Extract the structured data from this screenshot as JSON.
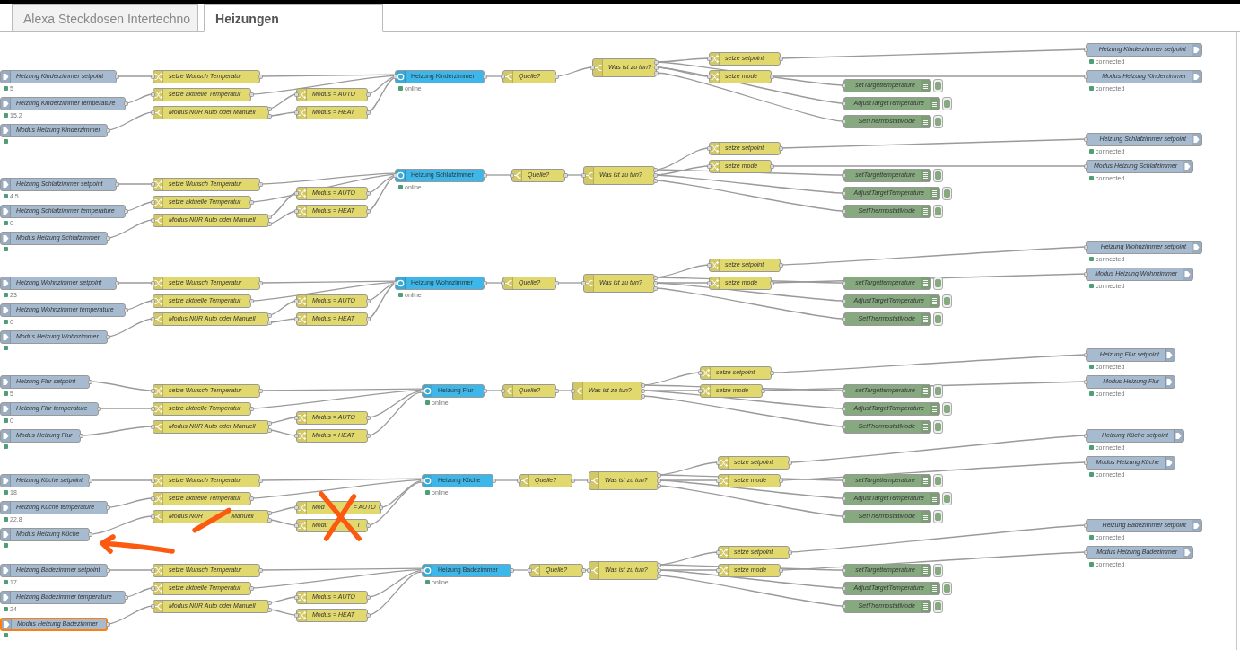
{
  "tabs": [
    {
      "label": "Alexa Steckdosen Intertechno",
      "selected": false
    },
    {
      "label": "Heizungen",
      "selected": true
    }
  ],
  "flow": [
    {
      "nodes": [
        {
          "kind": "input",
          "label": "Heizung Kinderzimmer setpoint",
          "selected": false,
          "status_dot": true,
          "status": "5"
        },
        {
          "kind": "input",
          "label": "Heizung Kinderzimmer temperature",
          "selected": false,
          "status_dot": true,
          "status": "15.2"
        },
        {
          "kind": "input",
          "label": "Modus Heizung Kinderzimmer",
          "selected": false,
          "status_dot": true
        },
        {
          "kind": "change",
          "label": "setze Wunsch Temperatur",
          "selected": false
        },
        {
          "kind": "change",
          "label": "setze aktuelle Temperatur",
          "selected": false
        },
        {
          "kind": "switch",
          "label": "Modus NUR Auto oder Manuell",
          "selected": false
        },
        {
          "kind": "change",
          "label": "Modus = AUTO",
          "selected": false
        },
        {
          "kind": "change",
          "label": "Modus = HEAT",
          "selected": false
        },
        {
          "kind": "device",
          "label": "Heizung Kinderzimmer",
          "selected": false,
          "status_dot": true,
          "status": "online"
        },
        {
          "kind": "switch",
          "label": "Quelle?",
          "selected": false
        },
        {
          "kind": "switch",
          "label": "Was ist zu tun?",
          "selected": false
        },
        {
          "kind": "change",
          "label": "setze setpoint",
          "selected": false
        },
        {
          "kind": "change",
          "label": "setze mode",
          "selected": false
        },
        {
          "kind": "debug",
          "label": "setTargettemperature",
          "selected": false,
          "enabled": true
        },
        {
          "kind": "debug",
          "label": "AdjustTargetTemperature",
          "selected": false,
          "enabled": true
        },
        {
          "kind": "debug",
          "label": "SetThermostatMode",
          "selected": false,
          "enabled": true
        },
        {
          "kind": "output",
          "label": "Heizung Kinderzimmer setpoint",
          "selected": false,
          "status_dot": true,
          "status": "connected"
        },
        {
          "kind": "output",
          "label": "Modus Heizung Kinderzimmer",
          "selected": false,
          "status_dot": true,
          "status": "connected"
        }
      ]
    },
    {
      "nodes": [
        {
          "kind": "input",
          "label": "Heizung Schlafzimmer setpoint",
          "selected": false,
          "status_dot": true,
          "status": "4.5"
        },
        {
          "kind": "input",
          "label": "Heizung Schlafzimmer temperature",
          "selected": false,
          "status_dot": true,
          "status": "0"
        },
        {
          "kind": "input",
          "label": "Modus Heizung Schlafzimmer",
          "selected": false,
          "status_dot": true
        },
        {
          "kind": "change",
          "label": "setze Wunsch Temperatur",
          "selected": false
        },
        {
          "kind": "change",
          "label": "setze aktuelle Temperatur",
          "selected": false
        },
        {
          "kind": "switch",
          "label": "Modus NUR Auto oder Manuell",
          "selected": false
        },
        {
          "kind": "change",
          "label": "Modus = AUTO",
          "selected": false
        },
        {
          "kind": "change",
          "label": "Modus = HEAT",
          "selected": false
        },
        {
          "kind": "device",
          "label": "Heizung Schlafzimmer",
          "selected": false,
          "status_dot": true,
          "status": "online"
        },
        {
          "kind": "switch",
          "label": "Quelle?",
          "selected": false
        },
        {
          "kind": "switch",
          "label": "Was ist zu tun?",
          "selected": false
        },
        {
          "kind": "change",
          "label": "setze setpoint",
          "selected": false
        },
        {
          "kind": "change",
          "label": "setze mode",
          "selected": false
        },
        {
          "kind": "debug",
          "label": "setTargettemperature",
          "selected": false,
          "enabled": true
        },
        {
          "kind": "debug",
          "label": "AdjustTargetTemperature",
          "selected": false,
          "enabled": true
        },
        {
          "kind": "debug",
          "label": "SetThermostatMode",
          "selected": false,
          "enabled": true
        },
        {
          "kind": "output",
          "label": "Heizung Schlafzimmer setpoint",
          "selected": false,
          "status_dot": true,
          "status": "connected"
        },
        {
          "kind": "output",
          "label": "Modus Heizung Schlafzimmer",
          "selected": false,
          "status_dot": true,
          "status": "connected"
        }
      ]
    },
    {
      "nodes": [
        {
          "kind": "input",
          "label": "Heizung Wohnzimmer setpoint",
          "selected": false,
          "status_dot": true,
          "status": "23"
        },
        {
          "kind": "input",
          "label": "Heizung Wohnzimmer temperature",
          "selected": false,
          "status_dot": true,
          "status": "0"
        },
        {
          "kind": "input",
          "label": "Modus Heizung Wohnzimmer",
          "selected": false,
          "status_dot": true
        },
        {
          "kind": "change",
          "label": "setze Wunsch Temperatur",
          "selected": false
        },
        {
          "kind": "change",
          "label": "setze aktuelle Temperatur",
          "selected": false
        },
        {
          "kind": "switch",
          "label": "Modus NUR Auto oder Manuell",
          "selected": false
        },
        {
          "kind": "change",
          "label": "Modus = AUTO",
          "selected": false
        },
        {
          "kind": "change",
          "label": "Modus = HEAT",
          "selected": false
        },
        {
          "kind": "device",
          "label": "Heizung Wohnzimmer",
          "selected": false,
          "status_dot": true,
          "status": "online"
        },
        {
          "kind": "switch",
          "label": "Quelle?",
          "selected": false
        },
        {
          "kind": "switch",
          "label": "Was ist zu tun?",
          "selected": false
        },
        {
          "kind": "change",
          "label": "setze setpoint",
          "selected": false
        },
        {
          "kind": "change",
          "label": "setze mode",
          "selected": false
        },
        {
          "kind": "debug",
          "label": "setTargettemperature",
          "selected": false,
          "enabled": true
        },
        {
          "kind": "debug",
          "label": "AdjustTargetTemperature",
          "selected": false,
          "enabled": true
        },
        {
          "kind": "debug",
          "label": "SetThermostatMode",
          "selected": false,
          "enabled": true
        },
        {
          "kind": "output",
          "label": "Heizung Wohnzimmer setpoint",
          "selected": false,
          "status_dot": true,
          "status": "connected"
        },
        {
          "kind": "output",
          "label": "Modus Heizung Wohnzimmer",
          "selected": false,
          "status_dot": true,
          "status": "connected"
        }
      ]
    },
    {
      "nodes": [
        {
          "kind": "input",
          "label": "Heizung Flur setpoint",
          "selected": false,
          "status_dot": true,
          "status": "5"
        },
        {
          "kind": "input",
          "label": "Heizung Flur temperature",
          "selected": false,
          "status_dot": true,
          "status": "0"
        },
        {
          "kind": "input",
          "label": "Modus Heizung Flur",
          "selected": false,
          "status_dot": true
        },
        {
          "kind": "change",
          "label": "setze Wunsch Temperatur",
          "selected": false
        },
        {
          "kind": "change",
          "label": "setze aktuelle Temperatur",
          "selected": false
        },
        {
          "kind": "switch",
          "label": "Modus NUR Auto oder Manuell",
          "selected": false
        },
        {
          "kind": "change",
          "label": "Modus = AUTO",
          "selected": false
        },
        {
          "kind": "change",
          "label": "Modus = HEAT",
          "selected": false
        },
        {
          "kind": "device",
          "label": "Heizung Flur",
          "selected": false,
          "status_dot": true,
          "status": "online"
        },
        {
          "kind": "switch",
          "label": "Quelle?",
          "selected": false
        },
        {
          "kind": "switch",
          "label": "Was ist zu tun?",
          "selected": false
        },
        {
          "kind": "change",
          "label": "setze setpoint",
          "selected": false
        },
        {
          "kind": "change",
          "label": "setze mode",
          "selected": false
        },
        {
          "kind": "debug",
          "label": "setTargettemperature",
          "selected": false,
          "enabled": true
        },
        {
          "kind": "debug",
          "label": "AdjustTargetTemperature",
          "selected": false,
          "enabled": true
        },
        {
          "kind": "debug",
          "label": "SetThermostatMode",
          "selected": false,
          "enabled": true
        },
        {
          "kind": "output",
          "label": "Heizung Flur setpoint",
          "selected": false,
          "status_dot": true,
          "status": "connected"
        },
        {
          "kind": "output",
          "label": "Modus Heizung Flur",
          "selected": false,
          "status_dot": true,
          "status": "connected"
        }
      ]
    },
    {
      "nodes": [
        {
          "kind": "input",
          "label": "Heizung Küche setpoint",
          "selected": false,
          "status_dot": true,
          "status": "18"
        },
        {
          "kind": "input",
          "label": "Heizung Küche temperature",
          "selected": false,
          "status_dot": true,
          "status": "22.8"
        },
        {
          "kind": "input",
          "label": "Modus Heizung Küche",
          "selected": false,
          "status_dot": true
        },
        {
          "kind": "change",
          "label": "setze Wunsch Temperatur",
          "selected": false
        },
        {
          "kind": "change",
          "label": "setze aktuelle Temperatur",
          "selected": false
        },
        {
          "kind": "switch",
          "label_parts": [
            "Modus NUR",
            "Manuell"
          ],
          "selected": false
        },
        {
          "kind": "change",
          "label_parts": [
            "Mod",
            "= AUTO"
          ],
          "selected": false
        },
        {
          "kind": "change",
          "label_parts": [
            "Modu",
            "T"
          ],
          "selected": false
        },
        {
          "kind": "device",
          "label": "Heizung Küche",
          "selected": false,
          "status_dot": true,
          "status": "online"
        },
        {
          "kind": "switch",
          "label": "Quelle?",
          "selected": false
        },
        {
          "kind": "switch",
          "label": "Was ist zu tun?",
          "selected": false
        },
        {
          "kind": "change",
          "label": "setze setpoint",
          "selected": false
        },
        {
          "kind": "change",
          "label": "setze mode",
          "selected": false
        },
        {
          "kind": "debug",
          "label": "setTargettemperature",
          "selected": false,
          "enabled": true
        },
        {
          "kind": "debug",
          "label": "AdjustTargetTemperature",
          "selected": false,
          "enabled": true
        },
        {
          "kind": "debug",
          "label": "SetThermostatMode",
          "selected": false,
          "enabled": true
        },
        {
          "kind": "output",
          "label": "Heizung Küche setpoint",
          "selected": false,
          "status_dot": true,
          "status": "connected"
        },
        {
          "kind": "output",
          "label": "Modus Heizung Küche",
          "selected": false,
          "status_dot": true,
          "status": "connected"
        }
      ],
      "annotations": [
        {
          "kind": "strike"
        },
        {
          "kind": "cross"
        },
        {
          "kind": "arrow"
        }
      ]
    },
    {
      "nodes": [
        {
          "kind": "input",
          "label": "Heizung Badezimmer setpoint",
          "selected": false,
          "status_dot": true,
          "status": "17"
        },
        {
          "kind": "input",
          "label": "Heizung Badezimmer temperature",
          "selected": false,
          "status_dot": true,
          "status": "24"
        },
        {
          "kind": "input",
          "label": "Modus Heizung Badezimmer",
          "selected": true,
          "status_dot": true
        },
        {
          "kind": "change",
          "label": "setze Wunsch Temperatur",
          "selected": false
        },
        {
          "kind": "change",
          "label": "setze aktuelle Temperatur",
          "selected": false
        },
        {
          "kind": "switch",
          "label": "Modus NUR Auto oder Manuell",
          "selected": false
        },
        {
          "kind": "change",
          "label": "Modus = AUTO",
          "selected": false
        },
        {
          "kind": "change",
          "label": "Modus = HEAT",
          "selected": false
        },
        {
          "kind": "device",
          "label": "Heizung Badezimmer",
          "selected": false,
          "status_dot": true,
          "status": "online"
        },
        {
          "kind": "switch",
          "label": "Quelle?",
          "selected": false
        },
        {
          "kind": "switch",
          "label": "Was ist zu tun?",
          "selected": false
        },
        {
          "kind": "change",
          "label": "setze setpoint",
          "selected": false
        },
        {
          "kind": "change",
          "label": "setze mode",
          "selected": false
        },
        {
          "kind": "debug",
          "label": "setTargettemperature",
          "selected": false,
          "enabled": true
        },
        {
          "kind": "debug",
          "label": "AdjustTargetTemperature",
          "selected": false,
          "enabled": true
        },
        {
          "kind": "debug",
          "label": "SetThermostatMode",
          "selected": false,
          "enabled": true
        },
        {
          "kind": "output",
          "label": "Heizung Badezimmer setpoint",
          "selected": false,
          "status_dot": true,
          "status": "connected"
        },
        {
          "kind": "output",
          "label": "Modus Heizung Badezimmer",
          "selected": false,
          "status_dot": true,
          "status": "connected"
        }
      ]
    }
  ]
}
